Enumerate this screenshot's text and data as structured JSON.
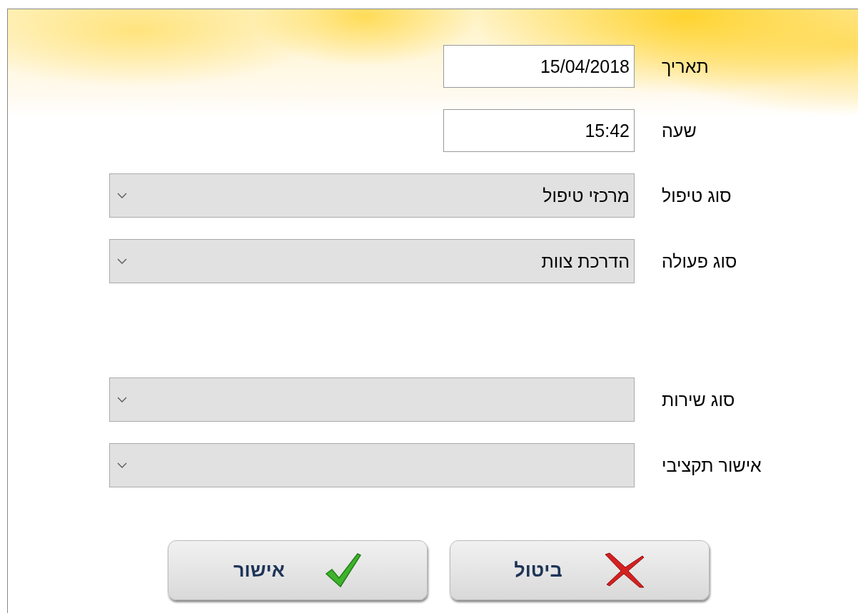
{
  "fields": [
    {
      "label": "תאריך",
      "kind": "text",
      "value": "15/04/2018"
    },
    {
      "label": "שעה",
      "kind": "text",
      "value": "15:42"
    },
    {
      "label": "סוג טיפול",
      "kind": "select",
      "value": "מרכזי טיפול"
    },
    {
      "label": "סוג פעולה",
      "kind": "select",
      "value": "הדרכת צוות"
    },
    {
      "label": "סוג שירות",
      "kind": "select"
    },
    {
      "label": "אישור תקציבי",
      "kind": "select"
    }
  ],
  "buttons": [
    {
      "label": "ביטול",
      "kind": "cancel"
    },
    {
      "label": "אישור",
      "kind": "ok"
    }
  ]
}
